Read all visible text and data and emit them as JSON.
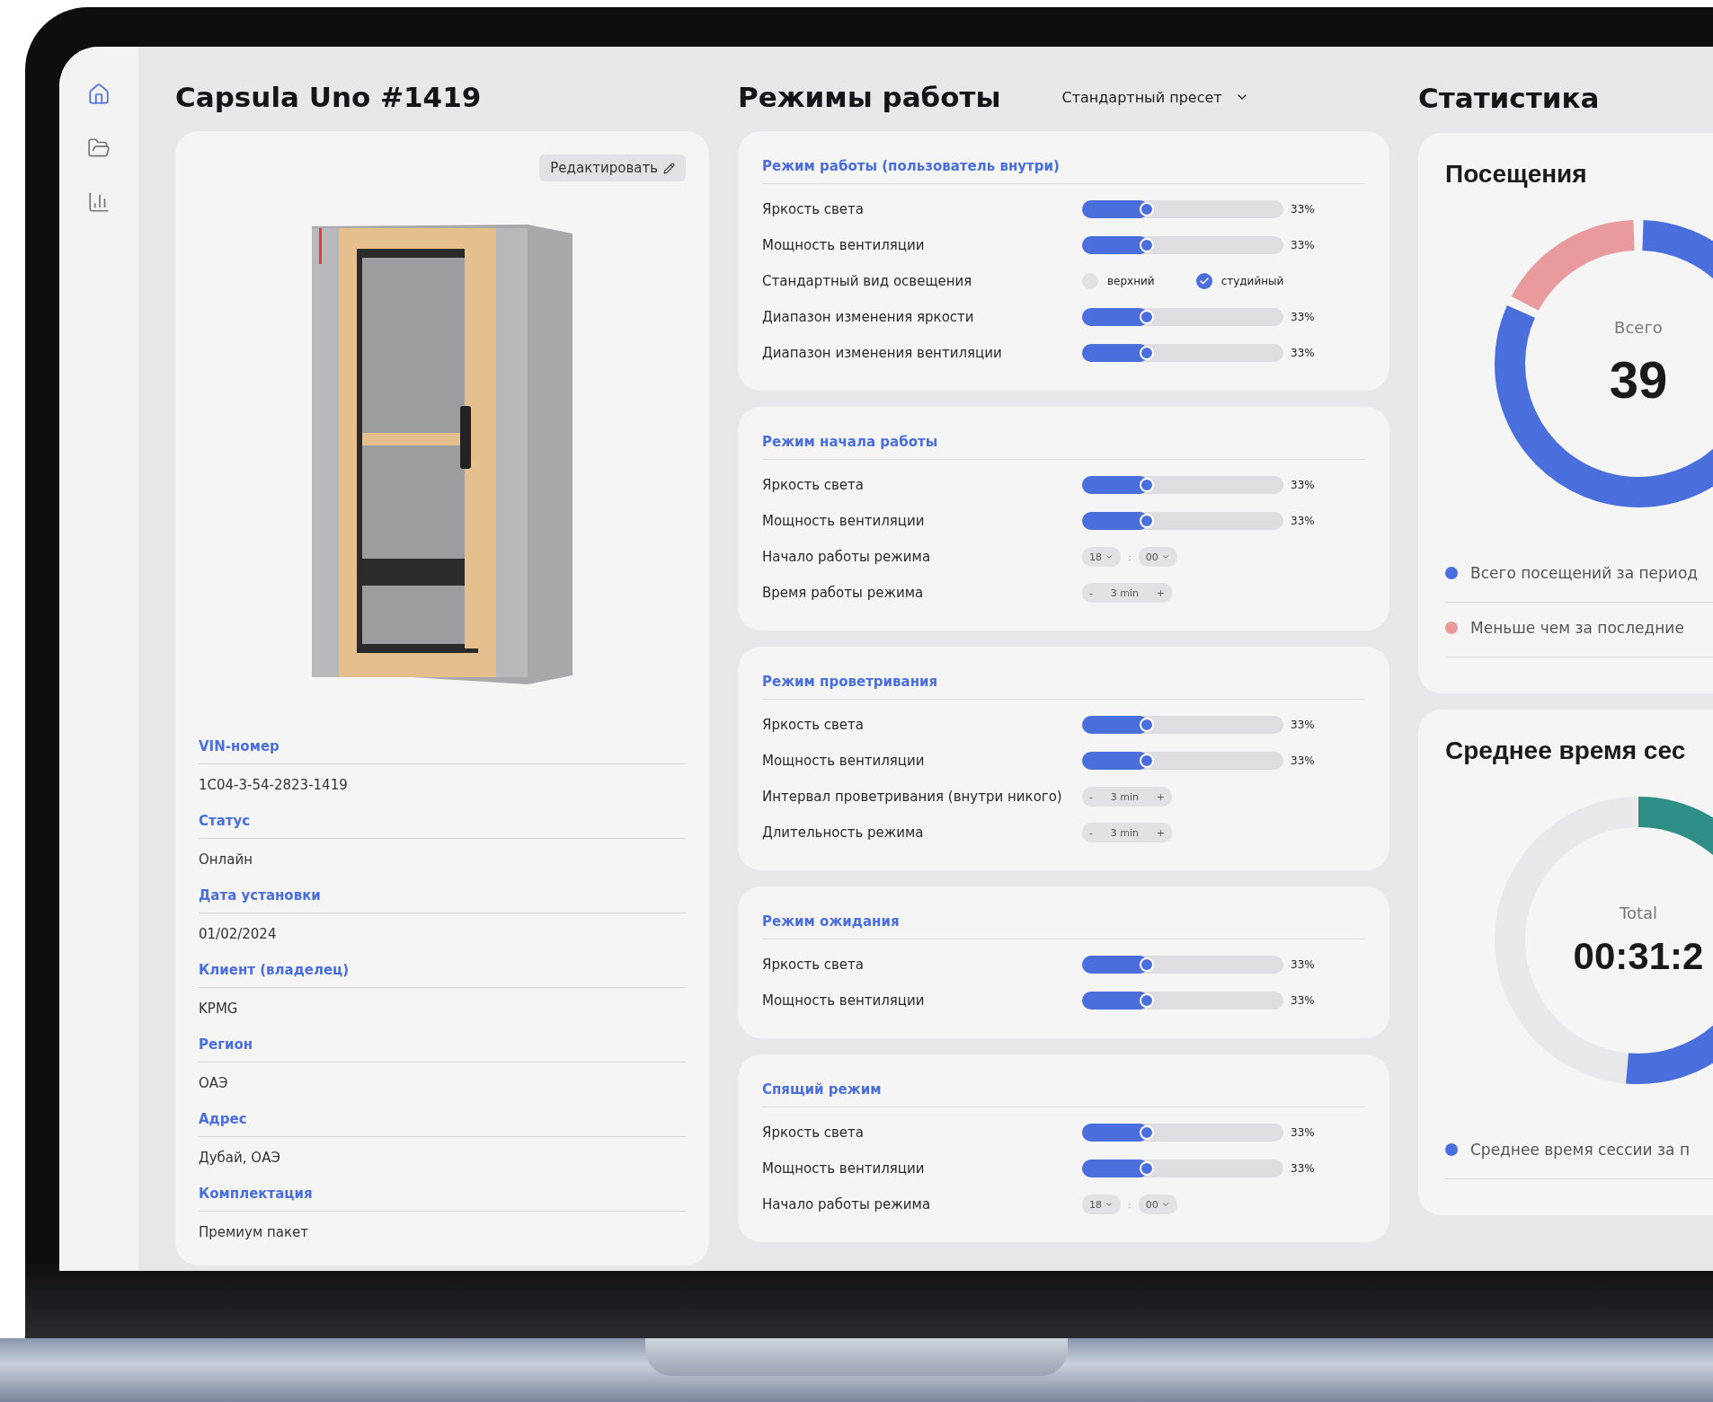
{
  "sidebar": {
    "items": [
      {
        "selected": true
      },
      {
        "selected": false
      },
      {
        "selected": false
      }
    ]
  },
  "device": {
    "title": "Capsula Uno #1419",
    "edit_button": "Редактировать",
    "fields": [
      {
        "label": "VIN-номер",
        "value": "1C04-3-54-2823-1419"
      },
      {
        "label": "Статус",
        "value": "Онлайн"
      },
      {
        "label": "Дата установки",
        "value": "01/02/2024"
      },
      {
        "label": "Клиент (владелец)",
        "value": "KPMG"
      },
      {
        "label": "Регион",
        "value": "ОАЭ"
      },
      {
        "label": "Адрес",
        "value": "Дубай, ОАЭ"
      },
      {
        "label": "Комплектация",
        "value": "Премиум пакет"
      }
    ]
  },
  "modes": {
    "title": "Режимы работы",
    "preset": "Стандартный пресет",
    "sections": [
      {
        "title": "Режим работы (пользователь внутри)",
        "rows": [
          {
            "kind": "slider",
            "label": "Яркость света",
            "level": 0.33,
            "reading": "33%"
          },
          {
            "kind": "slider",
            "label": "Мощность вентиляции",
            "level": 0.33,
            "reading": "33%"
          },
          {
            "kind": "radio",
            "label": "Стандартный вид освещения",
            "options": [
              {
                "label": "верхний",
                "selected": false
              },
              {
                "label": "студийный",
                "selected": true
              }
            ]
          },
          {
            "kind": "slider",
            "label": "Диапазон изменения яркости",
            "level": 0.33,
            "reading": "33%"
          },
          {
            "kind": "slider",
            "label": "Диапазон изменения вентиляции",
            "level": 0.33,
            "reading": "33%"
          }
        ]
      },
      {
        "title": "Режим начала работы",
        "rows": [
          {
            "kind": "slider",
            "label": "Яркость света",
            "level": 0.33,
            "reading": "33%"
          },
          {
            "kind": "slider",
            "label": "Мощность вентиляции",
            "level": 0.33,
            "reading": "33%"
          },
          {
            "kind": "time",
            "label": "Начало работы режима",
            "hour": "18",
            "separator": ":",
            "minute": "00"
          },
          {
            "kind": "stepper",
            "label": "Время работы режима",
            "minus": "-",
            "value": "3 min",
            "plus": "+"
          }
        ]
      },
      {
        "title": "Режим проветривания",
        "rows": [
          {
            "kind": "slider",
            "label": "Яркость света",
            "level": 0.33,
            "reading": "33%"
          },
          {
            "kind": "slider",
            "label": "Мощность вентиляции",
            "level": 0.33,
            "reading": "33%"
          },
          {
            "kind": "stepper",
            "label": "Интервал проветривания (внутри никого)",
            "minus": "-",
            "value": "3 min",
            "plus": "+"
          },
          {
            "kind": "stepper",
            "label": "Длительность режима",
            "minus": "-",
            "value": "3 min",
            "plus": "+"
          }
        ]
      },
      {
        "title": "Режим ожидания",
        "rows": [
          {
            "kind": "slider",
            "label": "Яркость света",
            "level": 0.33,
            "reading": "33%"
          },
          {
            "kind": "slider",
            "label": "Мощность вентиляции",
            "level": 0.33,
            "reading": "33%"
          }
        ]
      },
      {
        "title": "Спящий режим",
        "rows": [
          {
            "kind": "slider",
            "label": "Яркость света",
            "level": 0.33,
            "reading": "33%"
          },
          {
            "kind": "slider",
            "label": "Мощность вентиляции",
            "level": 0.33,
            "reading": "33%"
          },
          {
            "kind": "time",
            "label": "Начало работы режима",
            "hour": "18",
            "separator": ":",
            "minute": "00"
          }
        ]
      }
    ]
  },
  "statistics": {
    "title": "Статистика",
    "cards": [
      {
        "kind": "visits",
        "title": "Посещения",
        "center_label": "Всего",
        "center_value": "39",
        "legend": [
          {
            "label": "Всего посещений за период",
            "color": "#4a6fdc"
          },
          {
            "label": "Меньше чем за последние",
            "color": "#e89a9c"
          }
        ]
      },
      {
        "kind": "session",
        "title": "Среднее время сес",
        "center_label": "Total",
        "center_value": "00:31:2",
        "legend": [
          {
            "label": "Среднее время сессии за п",
            "color": "#4a6fdc"
          }
        ]
      }
    ]
  }
}
